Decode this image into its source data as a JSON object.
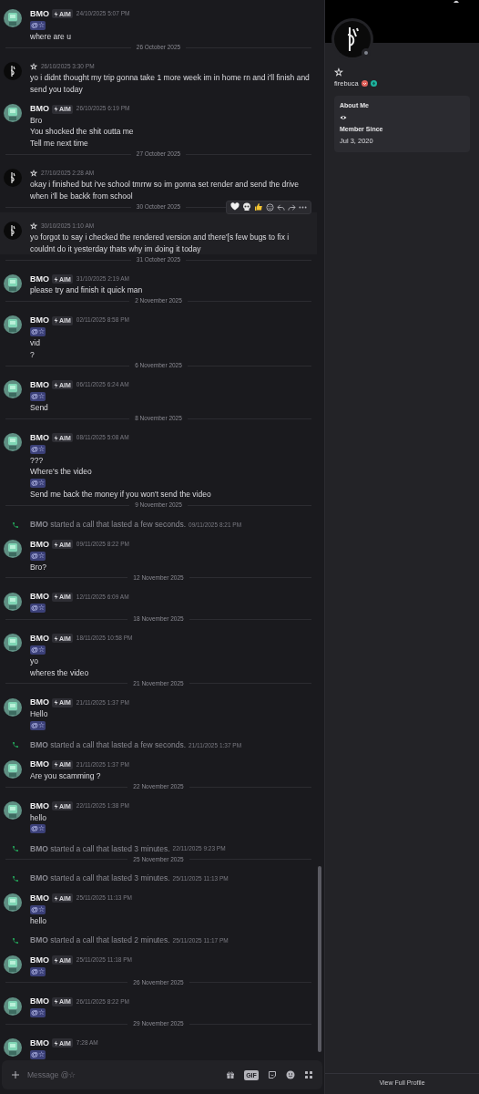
{
  "chat": {
    "items": [
      {
        "kind": "message",
        "avatar": {
          "kind": "bmo"
        },
        "author": "BMO",
        "tag": "AIM",
        "time": "24/10/2025 5:07 PM",
        "hovered": false,
        "lines": [
          {
            "kind": "mention",
            "text": "@☆"
          },
          {
            "kind": "text",
            "text": "where are u"
          }
        ]
      },
      {
        "kind": "divider",
        "text": "26 October 2025"
      },
      {
        "kind": "message",
        "avatar": {
          "kind": "star"
        },
        "author": "☆",
        "time": "26/10/2025 3:30 PM",
        "hovered": false,
        "lines": [
          {
            "kind": "text",
            "text": "yo i didnt thought my trip gonna take 1 more week im in home rn and i'll finish and send you today"
          }
        ]
      },
      {
        "kind": "message",
        "avatar": {
          "kind": "bmo"
        },
        "author": "BMO",
        "tag": "AIM",
        "time": "26/10/2025 6:19 PM",
        "hovered": false,
        "lines": [
          {
            "kind": "text",
            "text": "Bro"
          },
          {
            "kind": "text",
            "text": "You shocked the shit outta me"
          },
          {
            "kind": "text",
            "text": "Tell me next time"
          }
        ]
      },
      {
        "kind": "divider",
        "text": "27 October 2025"
      },
      {
        "kind": "message",
        "avatar": {
          "kind": "star"
        },
        "author": "☆",
        "time": "27/10/2025 2:28 AM",
        "hovered": false,
        "lines": [
          {
            "kind": "text",
            "text": "okay i finished but i've school tmrrw so im gonna set render and send the drive when i'll be backk from school"
          }
        ]
      },
      {
        "kind": "divider",
        "text": "30 October 2025"
      },
      {
        "kind": "message",
        "avatar": {
          "kind": "star"
        },
        "author": "☆",
        "time": "30/10/2025 1:10 AM",
        "hovered": true,
        "lines": [
          {
            "kind": "text",
            "text": "yo forgot to say i checked the rendered version and there'[s few bugs to fix i couldnt do it yesterday thats why im doing it today"
          }
        ]
      },
      {
        "kind": "divider",
        "text": "31 October 2025"
      },
      {
        "kind": "message",
        "avatar": {
          "kind": "bmo"
        },
        "author": "BMO",
        "tag": "AIM",
        "time": "31/10/2025 2:19 AM",
        "hovered": false,
        "lines": [
          {
            "kind": "text",
            "text": "please try and finish it quick man"
          }
        ]
      },
      {
        "kind": "divider",
        "text": "2 November 2025"
      },
      {
        "kind": "message",
        "avatar": {
          "kind": "bmo"
        },
        "author": "BMO",
        "tag": "AIM",
        "time": "02/11/2025 8:58 PM",
        "hovered": false,
        "lines": [
          {
            "kind": "mention",
            "text": "@☆"
          },
          {
            "kind": "text",
            "text": "vid"
          },
          {
            "kind": "text",
            "text": "?"
          }
        ]
      },
      {
        "kind": "divider",
        "text": "6 November 2025"
      },
      {
        "kind": "message",
        "avatar": {
          "kind": "bmo"
        },
        "author": "BMO",
        "tag": "AIM",
        "time": "06/11/2025 6:24 AM",
        "hovered": false,
        "lines": [
          {
            "kind": "mention",
            "text": "@☆"
          },
          {
            "kind": "text",
            "text": "Send"
          }
        ]
      },
      {
        "kind": "divider",
        "text": "8 November 2025"
      },
      {
        "kind": "message",
        "avatar": {
          "kind": "bmo"
        },
        "author": "BMO",
        "tag": "AIM",
        "time": "08/11/2025 5:08 AM",
        "hovered": false,
        "lines": [
          {
            "kind": "mention",
            "text": "@☆"
          },
          {
            "kind": "text",
            "text": "???"
          },
          {
            "kind": "text",
            "text": "Where's the video"
          },
          {
            "kind": "mention",
            "text": "@☆"
          },
          {
            "kind": "text",
            "text": "Send me back the money if you won't send the video"
          }
        ]
      },
      {
        "kind": "divider",
        "text": "9 November 2025"
      },
      {
        "kind": "call",
        "text": "**BMO** started a call that lasted a few seconds.",
        "time": "09/11/2025 8:21 PM"
      },
      {
        "kind": "message",
        "avatar": {
          "kind": "bmo"
        },
        "author": "BMO",
        "tag": "AIM",
        "time": "09/11/2025 8:22 PM",
        "hovered": false,
        "lines": [
          {
            "kind": "mention",
            "text": "@☆"
          },
          {
            "kind": "text",
            "text": "Bro?"
          }
        ]
      },
      {
        "kind": "divider",
        "text": "12 November 2025"
      },
      {
        "kind": "message",
        "avatar": {
          "kind": "bmo"
        },
        "author": "BMO",
        "tag": "AIM",
        "time": "12/11/2025 6:09 AM",
        "hovered": false,
        "lines": [
          {
            "kind": "mention",
            "text": "@☆"
          }
        ]
      },
      {
        "kind": "divider",
        "text": "18 November 2025"
      },
      {
        "kind": "message",
        "avatar": {
          "kind": "bmo"
        },
        "author": "BMO",
        "tag": "AIM",
        "time": "18/11/2025 10:58 PM",
        "hovered": false,
        "lines": [
          {
            "kind": "mention",
            "text": "@☆"
          },
          {
            "kind": "text",
            "text": "yo"
          },
          {
            "kind": "text",
            "text": "wheres the video"
          }
        ]
      },
      {
        "kind": "divider",
        "text": "21 November 2025"
      },
      {
        "kind": "message",
        "avatar": {
          "kind": "bmo"
        },
        "author": "BMO",
        "tag": "AIM",
        "time": "21/11/2025 1:37 PM",
        "hovered": false,
        "lines": [
          {
            "kind": "text",
            "text": "Hello"
          },
          {
            "kind": "mention",
            "text": "@☆"
          }
        ]
      },
      {
        "kind": "call",
        "text": "**BMO** started a call that lasted a few seconds.",
        "time": "21/11/2025 1:37 PM"
      },
      {
        "kind": "message",
        "avatar": {
          "kind": "bmo"
        },
        "author": "BMO",
        "tag": "AIM",
        "time": "21/11/2025 1:37 PM",
        "hovered": false,
        "lines": [
          {
            "kind": "text",
            "text": "Are you scamming ?"
          }
        ]
      },
      {
        "kind": "divider",
        "text": "22 November 2025"
      },
      {
        "kind": "message",
        "avatar": {
          "kind": "bmo"
        },
        "author": "BMO",
        "tag": "AIM",
        "time": "22/11/2025 1:38 PM",
        "hovered": false,
        "lines": [
          {
            "kind": "text",
            "text": "hello"
          },
          {
            "kind": "mention",
            "text": "@☆"
          }
        ]
      },
      {
        "kind": "call",
        "text": "**BMO** started a call that lasted 3 minutes.",
        "time": "22/11/2025 9:23 PM"
      },
      {
        "kind": "divider",
        "text": "25 November 2025"
      },
      {
        "kind": "call",
        "text": "**BMO** started a call that lasted 3 minutes.",
        "time": "25/11/2025 11:13 PM"
      },
      {
        "kind": "message",
        "avatar": {
          "kind": "bmo"
        },
        "author": "BMO",
        "tag": "AIM",
        "time": "25/11/2025 11:13 PM",
        "hovered": false,
        "lines": [
          {
            "kind": "mention",
            "text": "@☆"
          },
          {
            "kind": "text",
            "text": "hello"
          }
        ]
      },
      {
        "kind": "call",
        "text": "**BMO** started a call that lasted 2 minutes.",
        "time": "25/11/2025 11:17 PM"
      },
      {
        "kind": "message",
        "avatar": {
          "kind": "bmo"
        },
        "author": "BMO",
        "tag": "AIM",
        "time": "25/11/2025 11:18 PM",
        "hovered": false,
        "lines": [
          {
            "kind": "mention",
            "text": "@☆"
          }
        ]
      },
      {
        "kind": "divider",
        "text": "26 November 2025"
      },
      {
        "kind": "message",
        "avatar": {
          "kind": "bmo"
        },
        "author": "BMO",
        "tag": "AIM",
        "time": "26/11/2025 8:22 PM",
        "hovered": false,
        "lines": [
          {
            "kind": "mention",
            "text": "@☆"
          }
        ]
      },
      {
        "kind": "divider",
        "text": "29 November 2025"
      },
      {
        "kind": "message",
        "avatar": {
          "kind": "bmo"
        },
        "author": "BMO",
        "tag": "AIM",
        "time": "7:28 AM",
        "hovered": false,
        "lines": [
          {
            "kind": "mention",
            "text": "@☆"
          }
        ]
      }
    ]
  },
  "composer": {
    "placeholder": "Message @☆",
    "gif_label": "GIF"
  },
  "profile": {
    "display_name": "☆",
    "username": "firebuca",
    "status": {
      "kind": "offline"
    },
    "sections": [
      {
        "kind": "emoji",
        "title": "About Me"
      },
      {
        "kind": "text",
        "title": "Member Since",
        "value": "Jul 3, 2020"
      }
    ],
    "footer": "View Full Profile"
  }
}
